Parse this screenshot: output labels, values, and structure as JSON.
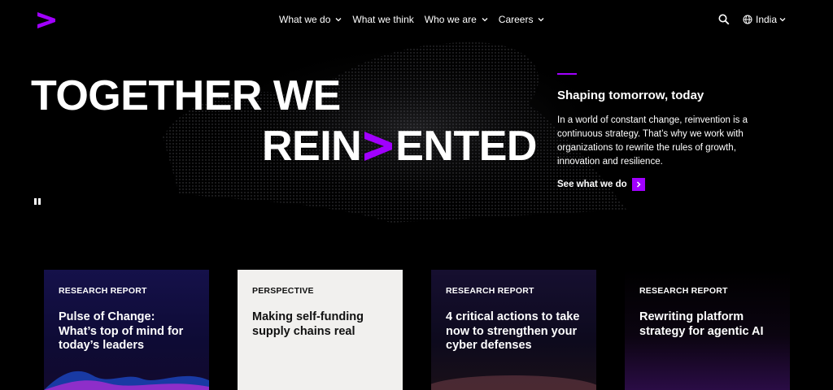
{
  "header": {
    "nav": [
      {
        "label": "What we do",
        "has_dropdown": true
      },
      {
        "label": "What we think",
        "has_dropdown": false
      },
      {
        "label": "Who we are",
        "has_dropdown": true
      },
      {
        "label": "Careers",
        "has_dropdown": true
      }
    ],
    "language": "India"
  },
  "hero": {
    "title_line1": "TOGETHER WE",
    "title_line2_prefix": "REIN",
    "title_line2_suffix": "ENTED",
    "side_title": "Shaping tomorrow, today",
    "side_body": "In a world of constant change, reinvention is a continuous strategy. That’s why we work with organizations to rewrite the rules of growth, innovation and resilience.",
    "cta_label": "See what we do"
  },
  "cards": [
    {
      "tag": "RESEARCH REPORT",
      "title": "Pulse of Change: What’s top of mind for today’s leaders"
    },
    {
      "tag": "PERSPECTIVE",
      "title": "Making self-funding supply chains real"
    },
    {
      "tag": "RESEARCH REPORT",
      "title": "4 critical actions to take now to strengthen your cyber defenses"
    },
    {
      "tag": "RESEARCH REPORT",
      "title": "Rewriting platform strategy for agentic AI"
    }
  ],
  "colors": {
    "accent": "#a100ff",
    "background": "#000000",
    "light_card": "#f1f0ee"
  }
}
